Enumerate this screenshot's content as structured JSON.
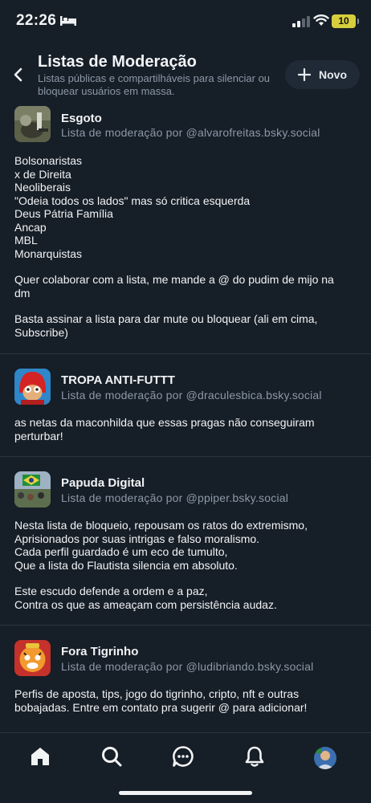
{
  "status_bar": {
    "time": "22:26",
    "battery": "10"
  },
  "header": {
    "title": "Listas de Moderação",
    "subtitle": "Listas públicas e compartilháveis para silenciar ou bloquear usuários em massa.",
    "new_button_label": "Novo"
  },
  "lists": [
    {
      "title": "Esgoto",
      "byline": "Lista de moderação por @alvarofreitas.bsky.social",
      "paragraphs": [
        "Bolsonaristas\nx de Direita\nNeoliberais\n\"Odeia todos os lados\" mas só critica esquerda\nDeus Pátria Família\nAncap\nMBL\nMonarquistas",
        "Quer colaborar com a lista, me mande a @ do pudim de mijo na dm",
        "Basta assinar a lista para dar mute ou bloquear (ali em cima, Subscribe)"
      ]
    },
    {
      "title": "TROPA ANTI-FUTTT",
      "byline": "Lista de moderação por @draculesbica.bsky.social",
      "paragraphs": [
        "as netas da maconhilda que essas pragas não conseguiram perturbar!"
      ]
    },
    {
      "title": "Papuda Digital",
      "byline": "Lista de moderação por @ppiper.bsky.social",
      "paragraphs": [
        "Nesta lista de bloqueio, repousam os ratos do extremismo,\nAprisionados por suas intrigas e falso moralismo.\nCada perfil guardado é um eco de tumulto,\nQue a lista do Flautista silencia em absoluto.",
        "Este escudo defende a ordem e a paz,\nContra os que as ameaçam com persistência audaz."
      ]
    },
    {
      "title": "Fora Tigrinho",
      "byline": "Lista de moderação por @ludibriando.bsky.social",
      "paragraphs": [
        "Perfis de aposta, tips, jogo do tigrinho, cripto, nft e outras bobajadas. Entre em contato pra sugerir @ para adicionar!"
      ]
    }
  ],
  "tabs": [
    "home-icon",
    "search-icon",
    "chat-icon",
    "bell-icon",
    "profile-avatar"
  ]
}
